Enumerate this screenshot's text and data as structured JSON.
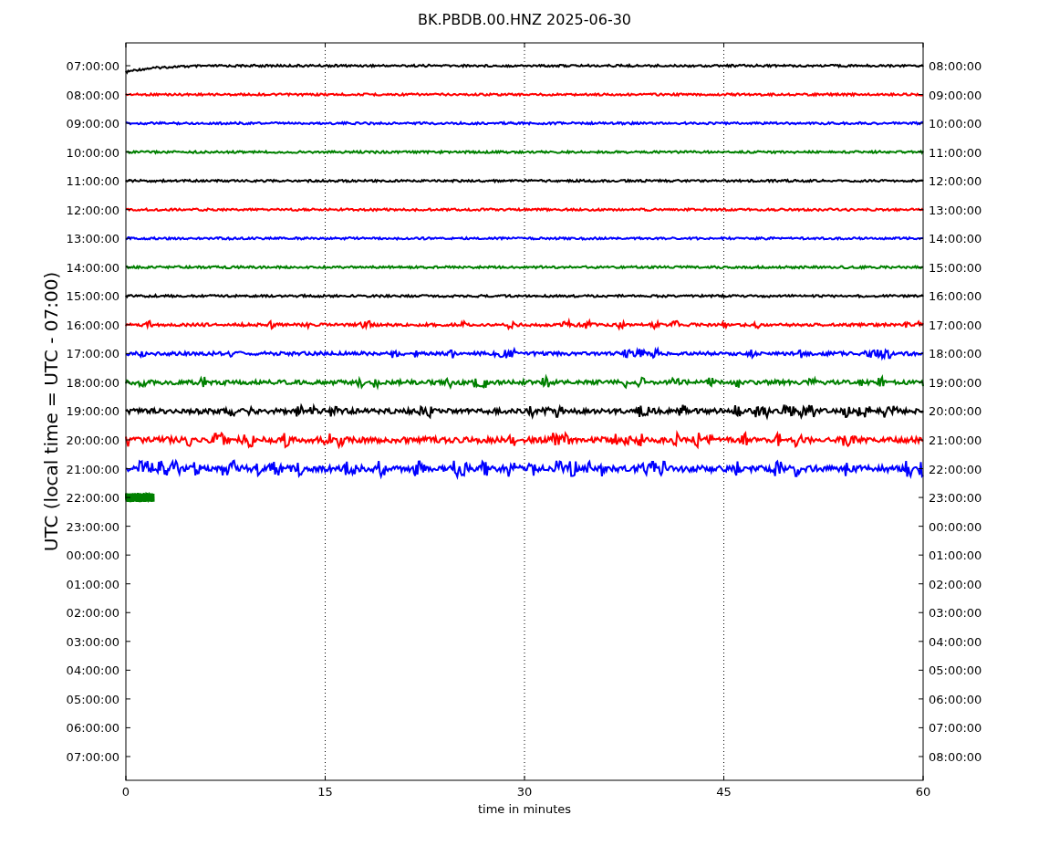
{
  "plot": {
    "title": "BK.PBDB.00.HNZ 2025-06-30",
    "ylabel": "UTC (local time = UTC - 07:00)",
    "xlabel": "time in minutes",
    "xticks": [
      "0",
      "15",
      "30",
      "45",
      "60"
    ],
    "left_labels": [
      "07:00:00",
      "08:00:00",
      "09:00:00",
      "10:00:00",
      "11:00:00",
      "12:00:00",
      "13:00:00",
      "14:00:00",
      "15:00:00",
      "16:00:00",
      "17:00:00",
      "18:00:00",
      "19:00:00",
      "20:00:00",
      "21:00:00",
      "22:00:00",
      "23:00:00",
      "00:00:00",
      "01:00:00",
      "02:00:00",
      "03:00:00",
      "04:00:00",
      "05:00:00",
      "06:00:00",
      "07:00:00"
    ],
    "right_labels": [
      "08:00:00",
      "09:00:00",
      "10:00:00",
      "11:00:00",
      "12:00:00",
      "13:00:00",
      "14:00:00",
      "15:00:00",
      "16:00:00",
      "17:00:00",
      "18:00:00",
      "19:00:00",
      "20:00:00",
      "21:00:00",
      "22:00:00",
      "23:00:00",
      "00:00:00",
      "01:00:00",
      "02:00:00",
      "03:00:00",
      "04:00:00",
      "05:00:00",
      "06:00:00",
      "07:00:00",
      "08:00:00"
    ],
    "traces": [
      {
        "color": "#000000",
        "level": 1
      },
      {
        "color": "#ff0000",
        "level": 1
      },
      {
        "color": "#0000ff",
        "level": 1
      },
      {
        "color": "#008000",
        "level": 1
      },
      {
        "color": "#000000",
        "level": 1
      },
      {
        "color": "#ff0000",
        "level": 1
      },
      {
        "color": "#0000ff",
        "level": 1
      },
      {
        "color": "#008000",
        "level": 1
      },
      {
        "color": "#000000",
        "level": 1
      },
      {
        "color": "#ff0000",
        "level": 1
      },
      {
        "color": "#0000ff",
        "level": 1
      },
      {
        "color": "#008000",
        "level": 1
      },
      {
        "color": "#000000",
        "level": 1
      },
      {
        "color": "#ff0000",
        "level": 1
      },
      {
        "color": "#0000ff",
        "level": 1
      },
      {
        "color": "#008000",
        "level": 0.035
      }
    ]
  }
}
